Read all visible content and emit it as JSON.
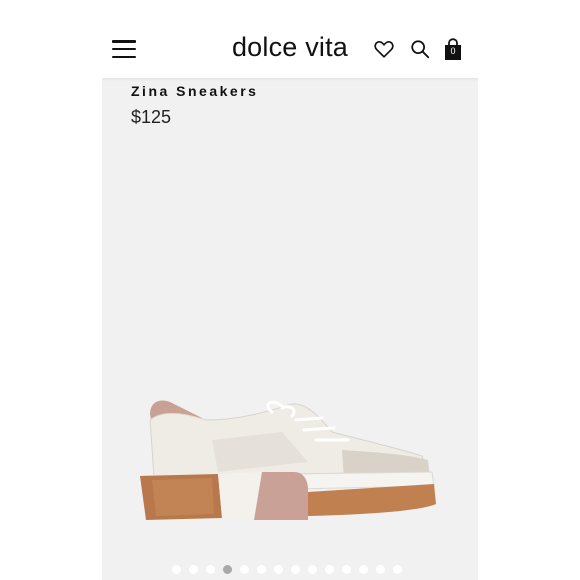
{
  "header": {
    "brand": "dolce vita",
    "bag_count": "0"
  },
  "product": {
    "name": "Zina Sneakers",
    "price": "$125"
  },
  "carousel": {
    "total": 14,
    "active_index": 3
  },
  "colors": {
    "accent_upper": "#ede9e3",
    "heel_tab": "#c9a094",
    "sole_copper": "#b9784c",
    "sole_pink": "#c9a196"
  }
}
